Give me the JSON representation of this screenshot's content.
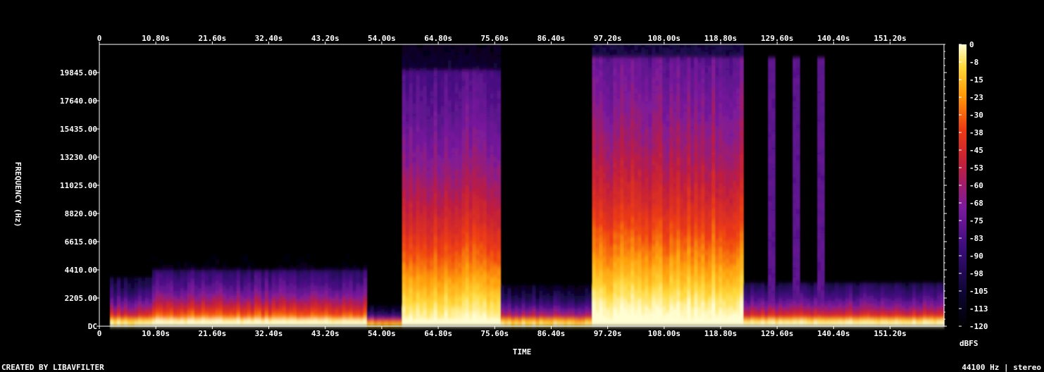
{
  "chart_data": {
    "type": "heatmap",
    "title": "",
    "xlabel": "TIME",
    "ylabel": "FREQUENCY (Hz)",
    "x_ticks": [
      "0",
      "10.80s",
      "21.60s",
      "32.40s",
      "43.20s",
      "54.00s",
      "64.80s",
      "75.60s",
      "86.40s",
      "97.20s",
      "108.00s",
      "118.80s",
      "129.60s",
      "140.40s",
      "151.20s"
    ],
    "x_tick_values": [
      0,
      10.8,
      21.6,
      32.4,
      43.2,
      54.0,
      64.8,
      75.6,
      86.4,
      97.2,
      108.0,
      118.8,
      129.6,
      140.4,
      151.2
    ],
    "xlim": [
      0,
      161.5
    ],
    "y_ticks": [
      "DC",
      "2205.00",
      "4410.00",
      "6615.00",
      "8820.00",
      "11025.00",
      "13230.00",
      "15435.00",
      "17640.00",
      "19845.00"
    ],
    "y_tick_values": [
      0,
      2205,
      4410,
      6615,
      8820,
      11025,
      13230,
      15435,
      17640,
      19845
    ],
    "ylim": [
      0,
      22050
    ],
    "colorbar": {
      "label": "dBFS",
      "ticks": [
        "0",
        "-8",
        "-15",
        "-23",
        "-30",
        "-38",
        "-45",
        "-53",
        "-60",
        "-68",
        "-75",
        "-83",
        "-90",
        "-98",
        "-105",
        "-113",
        "-120"
      ],
      "range": [
        -120,
        0
      ]
    },
    "segments": [
      {
        "t": [
          2,
          10
        ],
        "max_freq": 3800,
        "level_db": -70
      },
      {
        "t": [
          10,
          51
        ],
        "max_freq": 4500,
        "level_db": -60
      },
      {
        "t": [
          51,
          58
        ],
        "max_freq": 1600,
        "level_db": -75
      },
      {
        "t": [
          58,
          77
        ],
        "max_freq": 20000,
        "level_db": -50
      },
      {
        "t": [
          77,
          94
        ],
        "max_freq": 3200,
        "level_db": -75
      },
      {
        "t": [
          94,
          123
        ],
        "max_freq": 21000,
        "level_db": -45
      },
      {
        "t": [
          123,
          162
        ],
        "max_freq": 3500,
        "level_db": -65
      }
    ],
    "transients_s": [
      128.6,
      133.2,
      138.1
    ],
    "grid": false
  },
  "footer": {
    "left": "CREATED BY LIBAVFILTER",
    "right": "44100 Hz | stereo"
  },
  "colors": {
    "background": "#000000",
    "text": "#ffffff",
    "colormap": [
      "#000000",
      "#0d0633",
      "#3b0c7a",
      "#7b1a9e",
      "#c21f3a",
      "#ee3b13",
      "#ff9a08",
      "#ffd93a",
      "#fffdd2"
    ]
  }
}
